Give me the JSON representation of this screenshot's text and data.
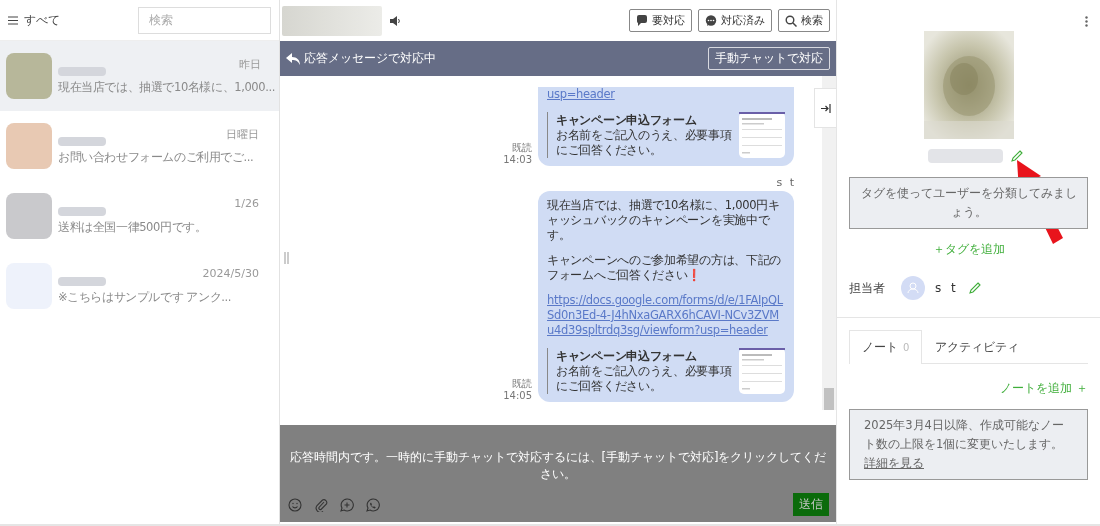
{
  "sidebar": {
    "filter_label": "すべて",
    "search": {
      "placeholder": "検索"
    },
    "chats": [
      {
        "date": "昨日",
        "preview": "現在当店では、抽選で10名様に、1,000...",
        "selected": true,
        "color": "#b7b79a"
      },
      {
        "date": "日曜日",
        "preview": "お問い合わせフォームのご利用でご...",
        "selected": false,
        "color": "#e8c9b3"
      },
      {
        "date": "1/26",
        "preview": "送料は全国一律500円です。",
        "selected": false,
        "color": "#c9c9cc"
      },
      {
        "date": "2024/5/30",
        "preview": "※こちらはサンプルです アンク...",
        "selected": false,
        "color": "#eef2fb"
      }
    ]
  },
  "chat": {
    "header": {
      "buttons": [
        {
          "label": "要対応",
          "kind": "flag"
        },
        {
          "label": "対応済み",
          "kind": "done"
        },
        {
          "label": "検索",
          "kind": "search"
        }
      ]
    },
    "banner": {
      "text": "応答メッセージで対応中",
      "button": "手動チャットで対応"
    },
    "messages": [
      {
        "link": "usp=header",
        "card": {
          "title": "キャンペーン申込フォーム",
          "description": "お名前をご記入のうえ、必要事項にご回答ください。"
        },
        "status": "既読",
        "time": "14:03"
      },
      {
        "sender": "s t",
        "paragraphs": [
          "現在当店では、抽選で10名様に、1,000円キャッシュバックのキャンペーンを実施中です。",
          "キャンペーンへのご参加希望の方は、下記のフォームへご回答ください❗"
        ],
        "link": "https://docs.google.com/forms/d/e/1FAIpQLSd0n3Ed-4-J4hNxaGARX6hCAVI-NCv3ZVMu4d39spltrdq3sg/viewform?usp=header",
        "card": {
          "title": "キャンペーン申込フォーム",
          "description": "お名前をご記入のうえ、必要事項にご回答ください。"
        },
        "status": "既読",
        "time": "14:05"
      }
    ],
    "composer": {
      "notice": "応答時間内です。一時的に手動チャットで対応するには、[手動チャットで対応]をクリックしてください。",
      "send": "送信"
    }
  },
  "profile": {
    "tag_hint": "タグを使ってユーザーを分類してみましょう。",
    "add_tag": "＋タグを追加",
    "assignee": {
      "label": "担当者",
      "name": "s t"
    },
    "tabs": [
      {
        "label": "ノート",
        "count": "0",
        "selected": true
      },
      {
        "label": "アクティビティ",
        "selected": false
      }
    ],
    "add_note": "ノートを追加 ＋",
    "notice": {
      "text": "2025年3月4日以降、作成可能なノート数の上限を1個に変更いたします。",
      "link": "詳細を見る"
    }
  }
}
